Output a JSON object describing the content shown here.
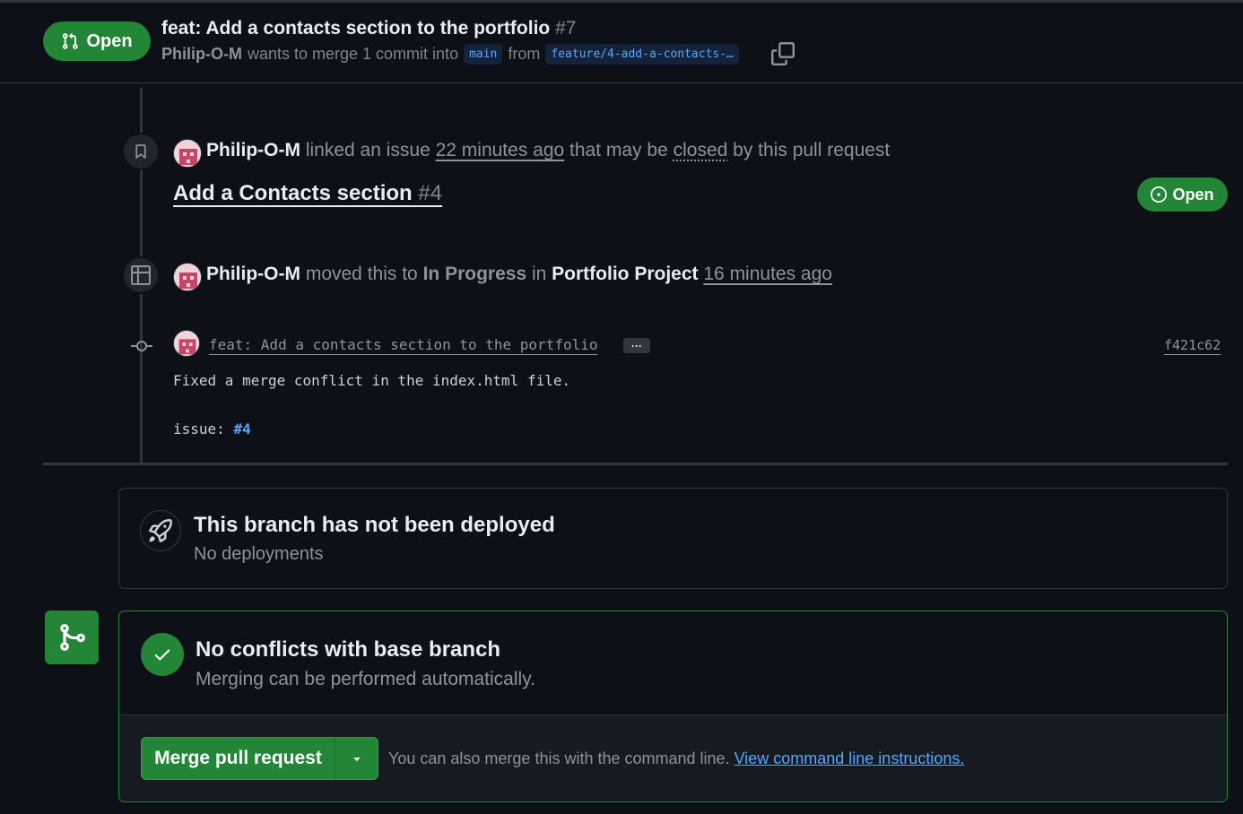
{
  "header": {
    "state_label": "Open",
    "title": "feat: Add a contacts section to the portfolio",
    "number": "#7",
    "author": "Philip-O-M",
    "merge_text": "wants to merge 1 commit into",
    "base_branch": "main",
    "from_text": "from",
    "head_branch": "feature/4-add-a-contacts-…"
  },
  "timeline": {
    "linked_event": {
      "author": "Philip-O-M",
      "action": "linked an issue",
      "time": "22 minutes ago",
      "suffix_pre": "that may be",
      "suffix_closed": "closed",
      "suffix_post": "by this pull request",
      "issue_title": "Add a Contacts section",
      "issue_number": "#4",
      "issue_state": "Open"
    },
    "project_event": {
      "author": "Philip-O-M",
      "action": "moved this to",
      "status": "In Progress",
      "in_text": "in",
      "project": "Portfolio Project",
      "time": "16 minutes ago"
    },
    "commit": {
      "message": "feat: Add a contacts section to the portfolio",
      "ellipsis": "···",
      "sha": "f421c62",
      "body": "Fixed a merge conflict in the index.html file.",
      "issue_prefix": "issue:",
      "issue_ref": "#4"
    }
  },
  "deployment": {
    "title": "This branch has not been deployed",
    "subtitle": "No deployments"
  },
  "merge": {
    "title": "No conflicts with base branch",
    "subtitle": "Merging can be performed automatically.",
    "button_label": "Merge pull request",
    "hint": "You can also merge this with the command line.",
    "hint_link": "View command line instructions."
  },
  "colors": {
    "background": "#0d1117",
    "accent_green": "#238636",
    "link_blue": "#58a6ff",
    "muted_text": "#8b949e",
    "border": "#30363d"
  }
}
